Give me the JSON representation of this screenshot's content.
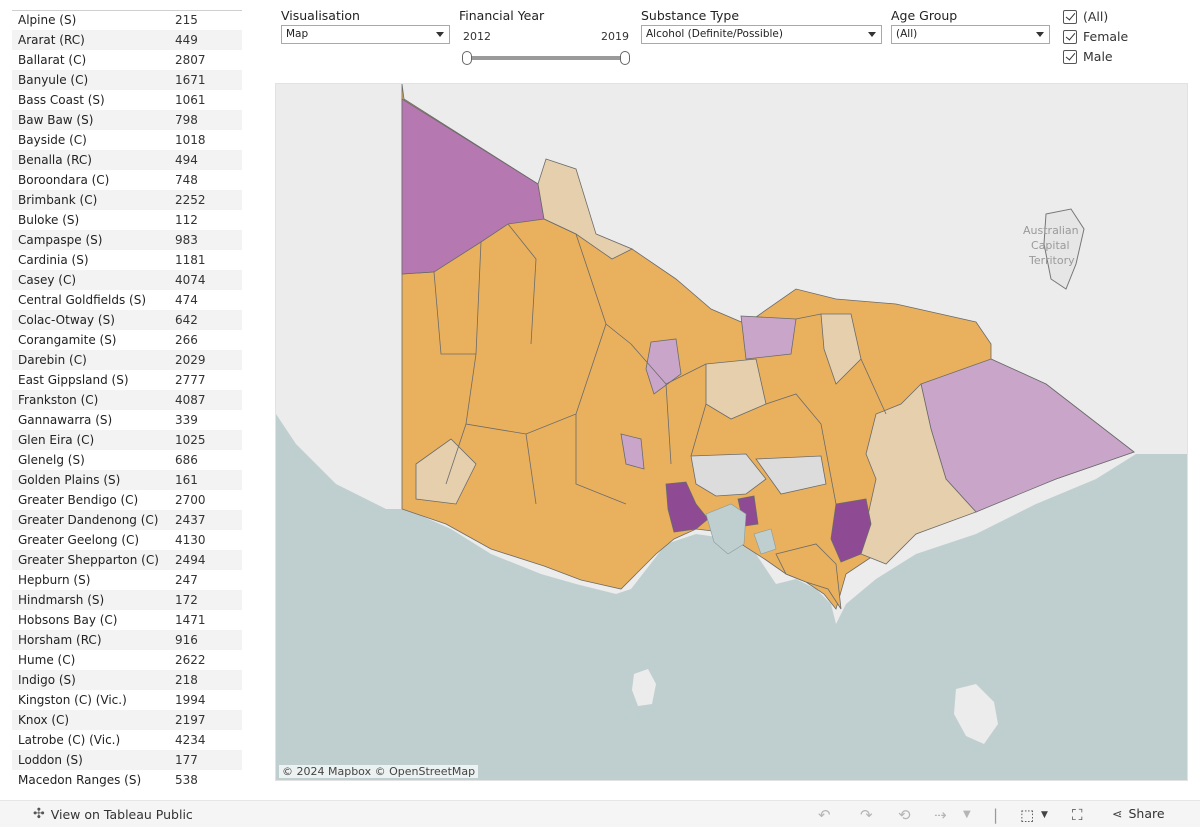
{
  "table": {
    "rows": [
      {
        "name": "Alpine (S)",
        "value": "215"
      },
      {
        "name": "Ararat (RC)",
        "value": "449"
      },
      {
        "name": "Ballarat (C)",
        "value": "2807"
      },
      {
        "name": "Banyule (C)",
        "value": "1671"
      },
      {
        "name": "Bass Coast (S)",
        "value": "1061"
      },
      {
        "name": "Baw Baw (S)",
        "value": "798"
      },
      {
        "name": "Bayside (C)",
        "value": "1018"
      },
      {
        "name": "Benalla (RC)",
        "value": "494"
      },
      {
        "name": "Boroondara (C)",
        "value": "748"
      },
      {
        "name": "Brimbank (C)",
        "value": "2252"
      },
      {
        "name": "Buloke (S)",
        "value": "112"
      },
      {
        "name": "Campaspe (S)",
        "value": "983"
      },
      {
        "name": "Cardinia (S)",
        "value": "1181"
      },
      {
        "name": "Casey (C)",
        "value": "4074"
      },
      {
        "name": "Central Goldfields (S)",
        "value": "474"
      },
      {
        "name": "Colac-Otway (S)",
        "value": "642"
      },
      {
        "name": "Corangamite (S)",
        "value": "266"
      },
      {
        "name": "Darebin (C)",
        "value": "2029"
      },
      {
        "name": "East Gippsland (S)",
        "value": "2777"
      },
      {
        "name": "Frankston (C)",
        "value": "4087"
      },
      {
        "name": "Gannawarra (S)",
        "value": "339"
      },
      {
        "name": "Glen Eira (C)",
        "value": "1025"
      },
      {
        "name": "Glenelg (S)",
        "value": "686"
      },
      {
        "name": "Golden Plains (S)",
        "value": "161"
      },
      {
        "name": "Greater Bendigo (C)",
        "value": "2700"
      },
      {
        "name": "Greater Dandenong (C)",
        "value": "2437"
      },
      {
        "name": "Greater Geelong (C)",
        "value": "4130"
      },
      {
        "name": "Greater Shepparton (C)",
        "value": "2494"
      },
      {
        "name": "Hepburn (S)",
        "value": "247"
      },
      {
        "name": "Hindmarsh (S)",
        "value": "172"
      },
      {
        "name": "Hobsons Bay (C)",
        "value": "1471"
      },
      {
        "name": "Horsham (RC)",
        "value": "916"
      },
      {
        "name": "Hume (C)",
        "value": "2622"
      },
      {
        "name": "Indigo (S)",
        "value": "218"
      },
      {
        "name": "Kingston (C) (Vic.)",
        "value": "1994"
      },
      {
        "name": "Knox (C)",
        "value": "2197"
      },
      {
        "name": "Latrobe (C) (Vic.)",
        "value": "4234"
      },
      {
        "name": "Loddon (S)",
        "value": "177"
      },
      {
        "name": "Macedon Ranges (S)",
        "value": "538"
      }
    ]
  },
  "filters": {
    "visualisation": {
      "label": "Visualisation",
      "value": "Map"
    },
    "financial_year": {
      "label": "Financial Year",
      "min": "2012",
      "max": "2019"
    },
    "substance": {
      "label": "Substance Type",
      "value": "Alcohol (Definite/Possible)"
    },
    "age": {
      "label": "Age Group",
      "value": "(All)"
    },
    "sex_options": [
      "(All)",
      "Female",
      "Male"
    ]
  },
  "map": {
    "attribution": "© 2024 Mapbox  © OpenStreetMap",
    "labels": [
      "Australian",
      "Capital",
      "Territory"
    ],
    "colors": {
      "land": "#ececec",
      "water": "#bfcfcf",
      "orange": "#e9b05d",
      "orange_light": "#e3b678",
      "tan": "#e6cfad",
      "lavender": "#c9a6c9",
      "purple": "#b678b0",
      "purple_dark": "#8e4a93",
      "grey": "#dcdcdc"
    }
  },
  "toolbar": {
    "view_label": "View on Tableau Public",
    "share_label": "Share"
  }
}
